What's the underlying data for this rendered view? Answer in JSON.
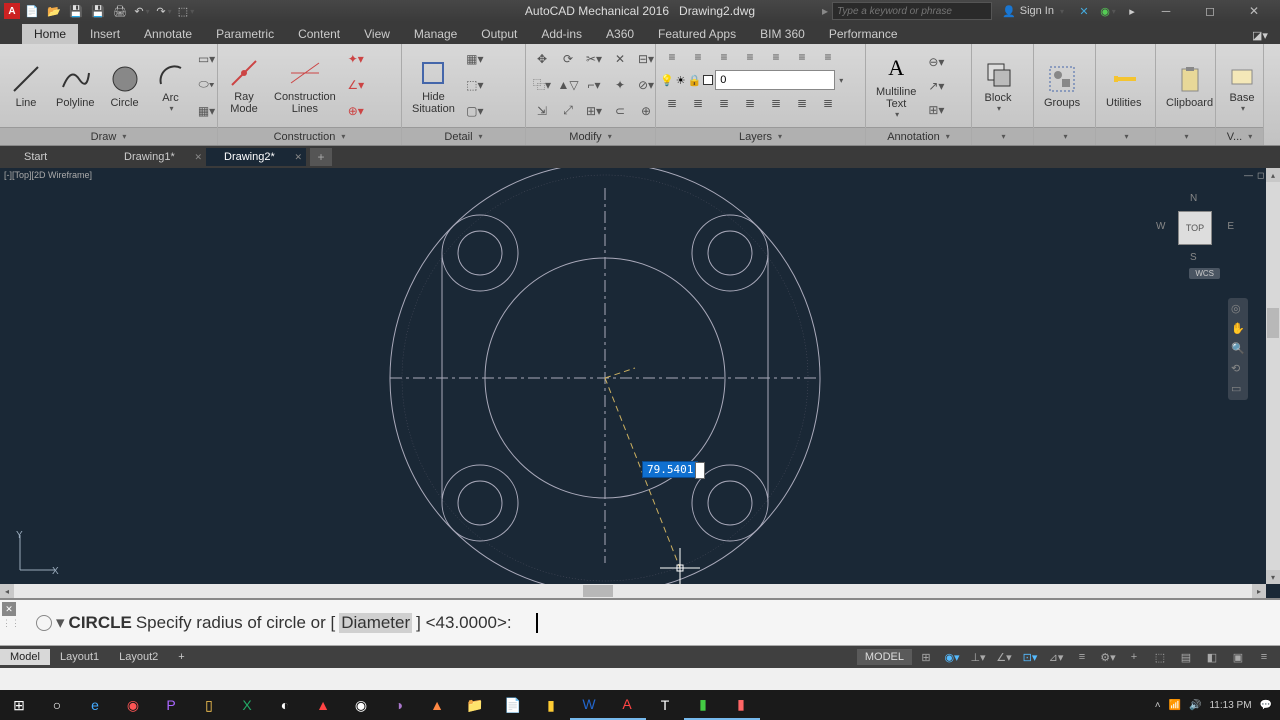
{
  "title_bar": {
    "app": "AutoCAD Mechanical 2016",
    "doc": "Drawing2.dwg",
    "search_placeholder": "Type a keyword or phrase",
    "signin": "Sign In"
  },
  "ribbon_tabs": [
    "Home",
    "Insert",
    "Annotate",
    "Parametric",
    "Content",
    "View",
    "Manage",
    "Output",
    "Add-ins",
    "A360",
    "Featured Apps",
    "BIM 360",
    "Performance"
  ],
  "active_ribbon_tab": 0,
  "panels": {
    "draw": {
      "title": "Draw",
      "buttons": {
        "line": "Line",
        "polyline": "Polyline",
        "circle": "Circle",
        "arc": "Arc"
      }
    },
    "construction": {
      "title": "Construction",
      "buttons": {
        "ray": "Ray\nMode",
        "clines": "Construction\nLines"
      }
    },
    "detail": {
      "title": "Detail",
      "buttons": {
        "hide": "Hide\nSituation"
      }
    },
    "modify": {
      "title": "Modify"
    },
    "layers": {
      "title": "Layers",
      "current": "0"
    },
    "annotation": {
      "title": "Annotation",
      "mtext": "Multiline\nText"
    },
    "block": {
      "title": "Block",
      "block": "Block"
    },
    "groups": {
      "title": "Groups",
      "groups": "Groups"
    },
    "utilities": "Utilities",
    "clipboard": "Clipboard",
    "base": "Base",
    "view": "V..."
  },
  "file_tabs": [
    {
      "label": "Start",
      "active": false,
      "closable": false
    },
    {
      "label": "Drawing1*",
      "active": false,
      "closable": true
    },
    {
      "label": "Drawing2*",
      "active": true,
      "closable": true
    }
  ],
  "canvas": {
    "view_label": "[-][Top][2D Wireframe]",
    "viewcube": {
      "top": "TOP",
      "n": "N",
      "s": "S",
      "e": "E",
      "w": "W",
      "wcs": "WCS"
    },
    "dim_value": "79.5401",
    "ucs": {
      "x": "X",
      "y": "Y"
    }
  },
  "command_line": {
    "command": "CIRCLE",
    "prompt": "Specify radius of circle or [",
    "option": "Diameter",
    "suffix": "] <43.0000>:"
  },
  "layout_tabs": [
    "Model",
    "Layout1",
    "Layout2"
  ],
  "active_layout": 0,
  "status": {
    "model": "MODEL"
  },
  "taskbar": {
    "time": "11:13 PM",
    "date": ""
  }
}
